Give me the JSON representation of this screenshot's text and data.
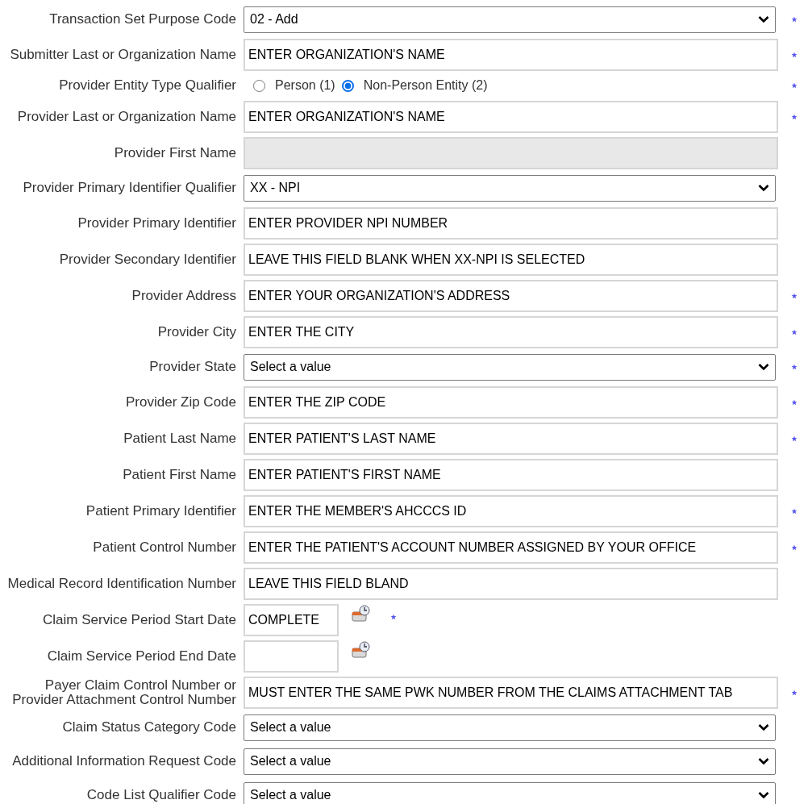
{
  "fields": [
    {
      "label": "Transaction Set Purpose Code",
      "kind": "select",
      "value": "02 - Add",
      "required": true
    },
    {
      "label": "Submitter Last or Organization Name",
      "kind": "text",
      "value": "ENTER ORGANIZATION'S NAME",
      "required": true
    },
    {
      "label": "Provider Entity Type Qualifier",
      "kind": "radio",
      "options": [
        {
          "label": "Person (1)",
          "selected": false
        },
        {
          "label": "Non-Person Entity (2)",
          "selected": true
        }
      ],
      "required": true
    },
    {
      "label": "Provider Last or Organization Name",
      "kind": "text",
      "value": "ENTER ORGANIZATION'S NAME",
      "required": true
    },
    {
      "label": "Provider First Name",
      "kind": "text",
      "disabled": true,
      "required": false
    },
    {
      "label": "Provider Primary Identifier Qualifier",
      "kind": "select",
      "value": "XX - NPI",
      "required": false
    },
    {
      "label": "Provider Primary Identifier",
      "kind": "text",
      "value": "ENTER PROVIDER NPI NUMBER",
      "required": false
    },
    {
      "label": "Provider Secondary Identifier",
      "kind": "text",
      "value": "LEAVE THIS FIELD BLANK WHEN XX-NPI IS SELECTED",
      "required": false
    },
    {
      "label": "Provider Address",
      "kind": "text",
      "value": "ENTER YOUR ORGANIZATION'S ADDRESS",
      "required": true
    },
    {
      "label": "Provider City",
      "kind": "text",
      "value": "ENTER THE CITY",
      "required": true
    },
    {
      "label": "Provider State",
      "kind": "select",
      "value": "Select a value",
      "required": true
    },
    {
      "label": "Provider Zip Code",
      "kind": "text",
      "value": "ENTER THE ZIP CODE",
      "required": true
    },
    {
      "label": "Patient Last Name",
      "kind": "text",
      "value": "ENTER PATIENT'S LAST NAME",
      "required": true
    },
    {
      "label": "Patient First Name",
      "kind": "text",
      "value": "ENTER PATIENT'S FIRST NAME",
      "required": false
    },
    {
      "label": "Patient Primary Identifier",
      "kind": "text",
      "value": "ENTER THE MEMBER'S AHCCCS ID",
      "required": true
    },
    {
      "label": "Patient Control Number",
      "kind": "text",
      "value": "ENTER THE PATIENT'S ACCOUNT NUMBER ASSIGNED BY YOUR OFFICE",
      "required": true
    },
    {
      "label": "Medical Record Identification Number",
      "kind": "text",
      "value": "LEAVE THIS FIELD BLAND",
      "required": false
    },
    {
      "label": "Claim Service Period Start Date",
      "kind": "date",
      "value": "COMPLETE",
      "required": true
    },
    {
      "label": "Claim Service Period End Date",
      "kind": "date",
      "required": false
    },
    {
      "label": "Payer Claim Control Number or Provider Attachment Control Number",
      "kind": "text",
      "value": "MUST ENTER THE SAME PWK NUMBER FROM THE CLAIMS ATTACHMENT TAB",
      "required": true
    },
    {
      "label": "Claim Status Category Code",
      "kind": "select",
      "value": "Select a value",
      "required": false
    },
    {
      "label": "Additional Information Request Code",
      "kind": "select",
      "value": "Select a value",
      "required": false
    },
    {
      "label": "Code List Qualifier Code",
      "kind": "select",
      "value": "Select a value",
      "required": false
    }
  ]
}
